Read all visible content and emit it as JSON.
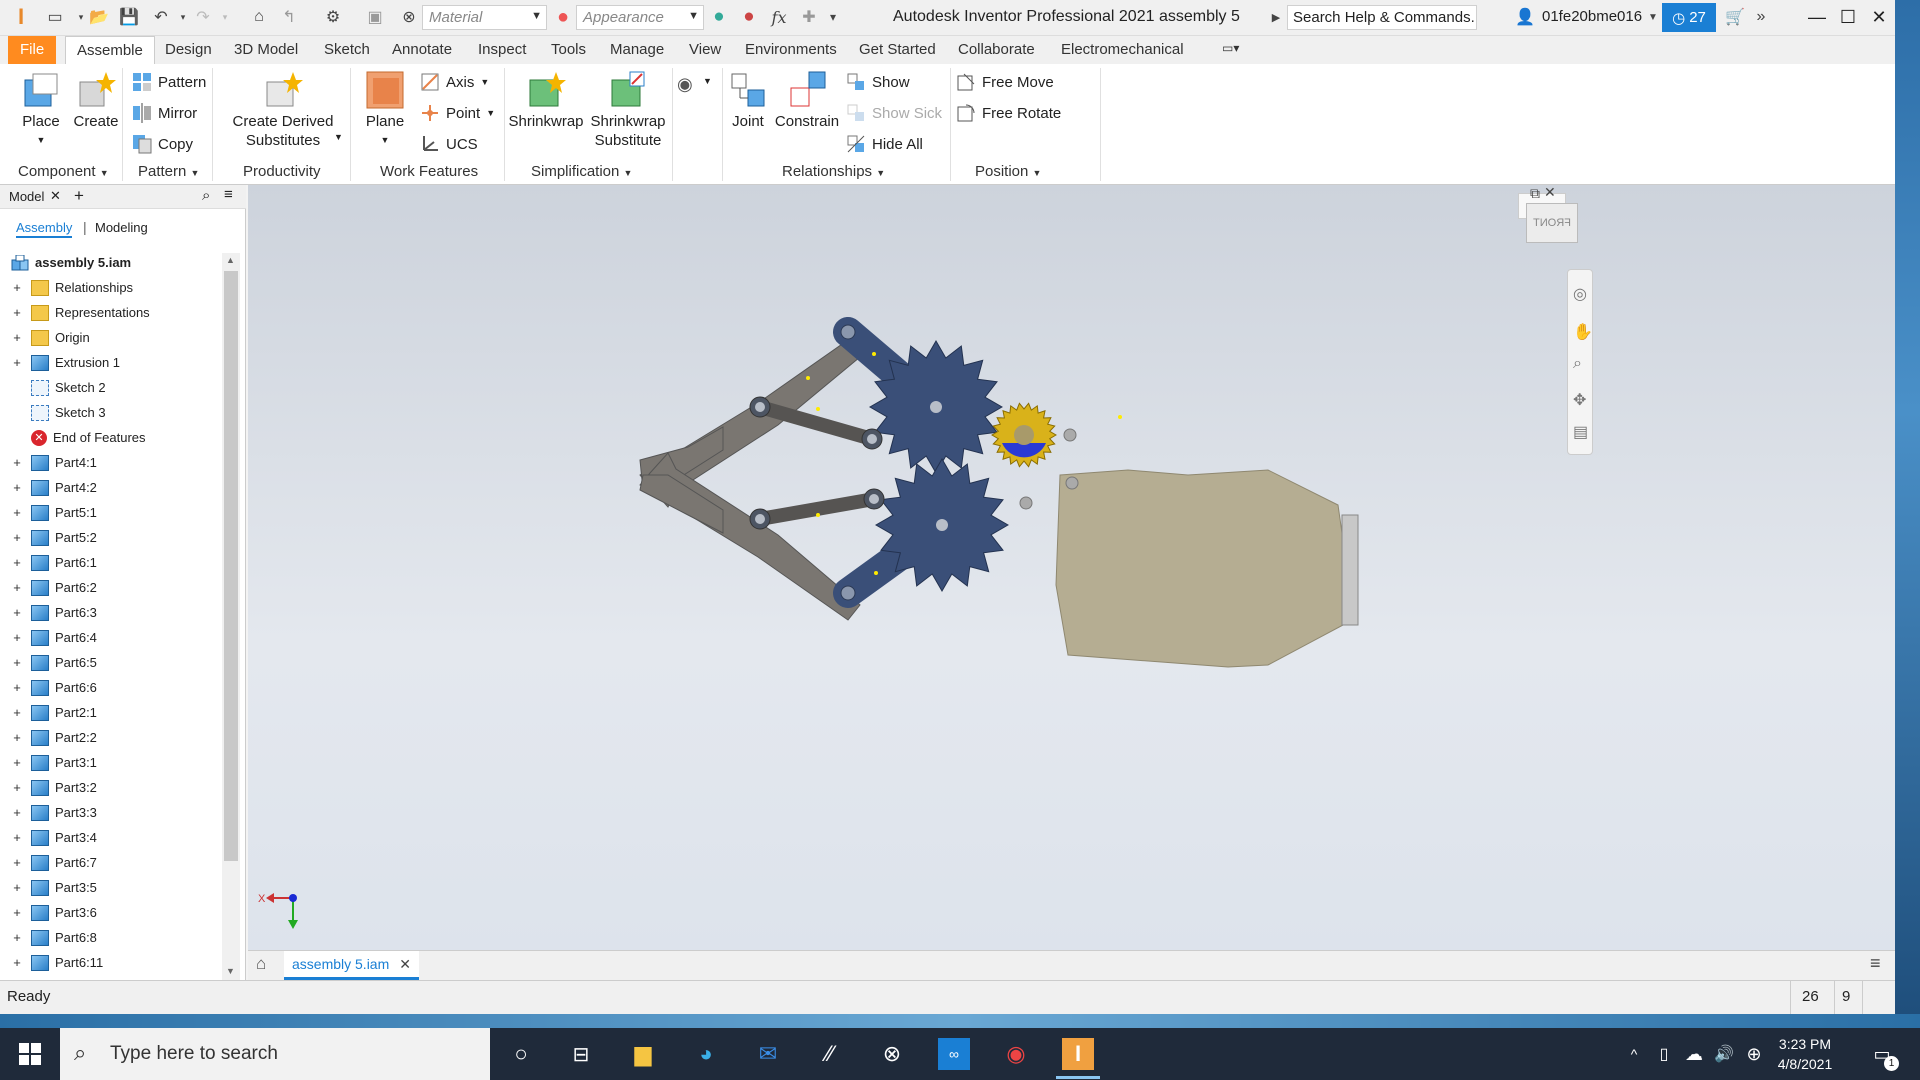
{
  "titlebar": {
    "material_placeholder": "Material",
    "appearance_placeholder": "Appearance",
    "title": "Autodesk Inventor Professional 2021    assembly 5",
    "search": "Search Help & Commands...",
    "user": "01fe20bme016",
    "badge_count": "27"
  },
  "ribbon_tabs": [
    "File",
    "Assemble",
    "Design",
    "3D Model",
    "Sketch",
    "Annotate",
    "Inspect",
    "Tools",
    "Manage",
    "View",
    "Environments",
    "Get Started",
    "Collaborate",
    "Electromechanical"
  ],
  "ribbon": {
    "place": "Place",
    "create": "Create",
    "pattern": "Pattern",
    "mirror": "Mirror",
    "copy": "Copy",
    "create_derived": "Create Derived",
    "substitutes": "Substitutes",
    "plane": "Plane",
    "axis": "Axis",
    "point": "Point",
    "ucs": "UCS",
    "shrinkwrap": "Shrinkwrap",
    "shrinkwrap_sub1": "Shrinkwrap",
    "shrinkwrap_sub2": "Substitute",
    "joint": "Joint",
    "constrain": "Constrain",
    "show": "Show",
    "show_sick": "Show Sick",
    "hide_all": "Hide All",
    "free_move": "Free Move",
    "free_rotate": "Free Rotate",
    "groups": {
      "component": "Component",
      "pattern": "Pattern",
      "productivity": "Productivity",
      "work_features": "Work Features",
      "simplification": "Simplification",
      "relationships": "Relationships",
      "position": "Position"
    }
  },
  "browser": {
    "tab_model": "Model",
    "sub_assembly": "Assembly",
    "sub_modeling": "Modeling",
    "root": "assembly 5.iam",
    "items": [
      {
        "label": "Relationships",
        "icon": "folder",
        "plus": true
      },
      {
        "label": "Representations",
        "icon": "folder",
        "plus": true
      },
      {
        "label": "Origin",
        "icon": "folder",
        "plus": true
      },
      {
        "label": "Extrusion 1",
        "icon": "cube",
        "plus": true
      },
      {
        "label": "Sketch 2",
        "icon": "sketch",
        "plus": false
      },
      {
        "label": "Sketch 3",
        "icon": "sketch",
        "plus": false
      },
      {
        "label": "End of Features",
        "icon": "end",
        "plus": false
      },
      {
        "label": "Part4:1",
        "icon": "cube",
        "plus": true
      },
      {
        "label": "Part4:2",
        "icon": "cube",
        "plus": true
      },
      {
        "label": "Part5:1",
        "icon": "cube",
        "plus": true
      },
      {
        "label": "Part5:2",
        "icon": "cube",
        "plus": true
      },
      {
        "label": "Part6:1",
        "icon": "cube",
        "plus": true
      },
      {
        "label": "Part6:2",
        "icon": "cube",
        "plus": true
      },
      {
        "label": "Part6:3",
        "icon": "cube",
        "plus": true
      },
      {
        "label": "Part6:4",
        "icon": "cube",
        "plus": true
      },
      {
        "label": "Part6:5",
        "icon": "cube",
        "plus": true
      },
      {
        "label": "Part6:6",
        "icon": "cube",
        "plus": true
      },
      {
        "label": "Part2:1",
        "icon": "cube",
        "plus": true
      },
      {
        "label": "Part2:2",
        "icon": "cube",
        "plus": true
      },
      {
        "label": "Part3:1",
        "icon": "cube",
        "plus": true
      },
      {
        "label": "Part3:2",
        "icon": "cube",
        "plus": true
      },
      {
        "label": "Part3:3",
        "icon": "cube",
        "plus": true
      },
      {
        "label": "Part3:4",
        "icon": "cube",
        "plus": true
      },
      {
        "label": "Part6:7",
        "icon": "cube",
        "plus": true
      },
      {
        "label": "Part3:5",
        "icon": "cube",
        "plus": true
      },
      {
        "label": "Part3:6",
        "icon": "cube",
        "plus": true
      },
      {
        "label": "Part6:8",
        "icon": "cube",
        "plus": true
      },
      {
        "label": "Part6:11",
        "icon": "cube",
        "plus": true
      }
    ]
  },
  "viewcube": "FRONT",
  "axis_x": "X",
  "doc_tab": "assembly 5.iam",
  "status": {
    "text": "Ready",
    "num1": "26",
    "num2": "9"
  },
  "taskbar": {
    "search": "Type here to search",
    "time": "3:23 PM",
    "date": "4/8/2021",
    "notifications": "1"
  },
  "colors": {
    "file_tab": "#ff8b1f",
    "badge": "#1a7fd4",
    "gear_blue": "#3a4f78",
    "linkage_gray": "#6e6b66",
    "base_tan": "#b5ad92",
    "small_gear": "#d9b21a"
  }
}
